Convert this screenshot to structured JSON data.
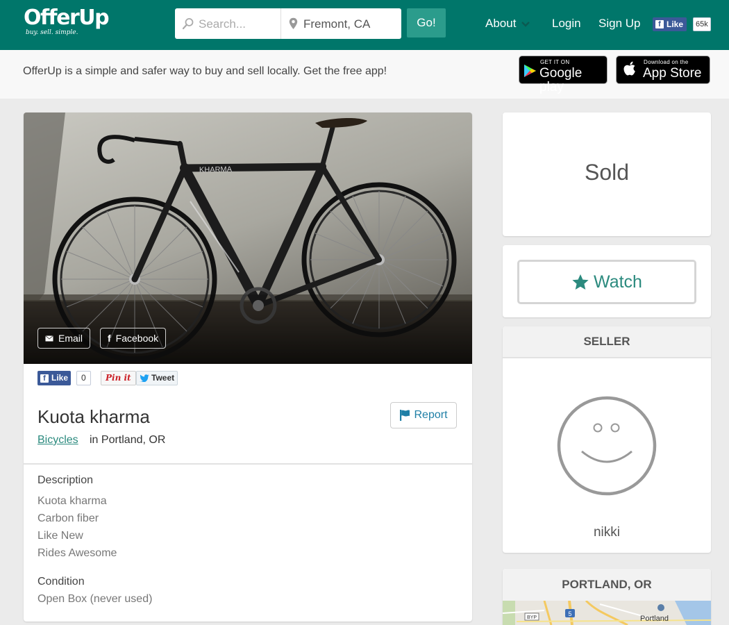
{
  "header": {
    "logo_text": "OfferUp",
    "logo_tagline": "buy. sell. simple.",
    "search_placeholder": "Search...",
    "location_value": "Fremont, CA",
    "go_label": "Go!",
    "nav": {
      "about": "About",
      "login": "Login",
      "signup": "Sign Up"
    },
    "fb_like_label": "Like",
    "fb_like_count": "65k",
    "brand_color": "#00766a"
  },
  "banner": {
    "text": "OfferUp is a simple and safer way to buy and sell locally. Get the free app!",
    "google_small": "GET IT ON",
    "google_big": "Google play",
    "apple_small": "Download on the",
    "apple_big": "App Store"
  },
  "listing": {
    "share_email": "Email",
    "share_facebook": "Facebook",
    "social": {
      "like": "Like",
      "like_count": "0",
      "pin": "Pin it",
      "tweet": "Tweet"
    },
    "title": "Kuota kharma",
    "category": "Bicycles",
    "location": "in Portland, OR",
    "report_label": "Report",
    "description_label": "Description",
    "description_lines": [
      "Kuota kharma",
      "Carbon fiber",
      "Like New",
      "Rides Awesome"
    ],
    "condition_label": "Condition",
    "condition_value": "Open Box (never used)",
    "photo_frame_text": "KHARMA"
  },
  "sidebar": {
    "status": "Sold",
    "watch_label": "Watch",
    "seller_header": "SELLER",
    "seller_name": "nikki",
    "location_header": "PORTLAND, OR",
    "map_label": "Portland",
    "map_shield": "5",
    "map_sign": "BYP"
  },
  "icons": {
    "search": "magnifier-icon",
    "location": "map-pin-icon",
    "star": "star-icon",
    "flag": "flag-icon",
    "avatar": "smiley-face-icon"
  }
}
